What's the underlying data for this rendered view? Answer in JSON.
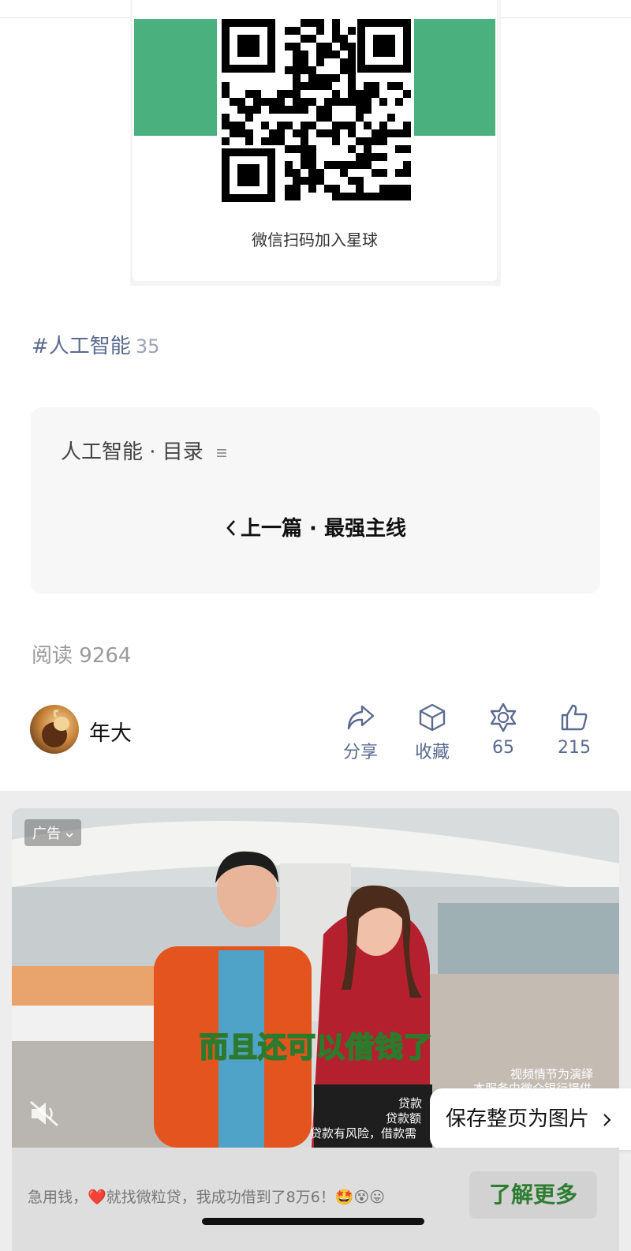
{
  "qr": {
    "caption": "微信扫码加入星球"
  },
  "tag": {
    "hash": "#",
    "name": "人工智能",
    "count": "35"
  },
  "toc": {
    "title": "人工智能 · 目录",
    "prev": "上一篇 · 最强主线"
  },
  "read": {
    "label": "阅读",
    "count": "9264"
  },
  "author": {
    "name": "年大"
  },
  "actions": {
    "share": "分享",
    "favorite": "收藏",
    "wow": "65",
    "like": "215"
  },
  "ad": {
    "badge": "广告",
    "subtitle": "而且还可以借钱了",
    "disclaimer_right_1": "视频情节为演绎",
    "disclaimer_right_2": "本服务由微众银行提供",
    "disclaimer_1": "贷款",
    "disclaimer_2": "贷款额",
    "disclaimer_3": "贷款有风险，借款需",
    "save_page": "保存整页为图片",
    "text": "急用钱，❤️就找微粒贷，我成功借到了8万6！🤩😵😛",
    "button": "了解更多"
  }
}
